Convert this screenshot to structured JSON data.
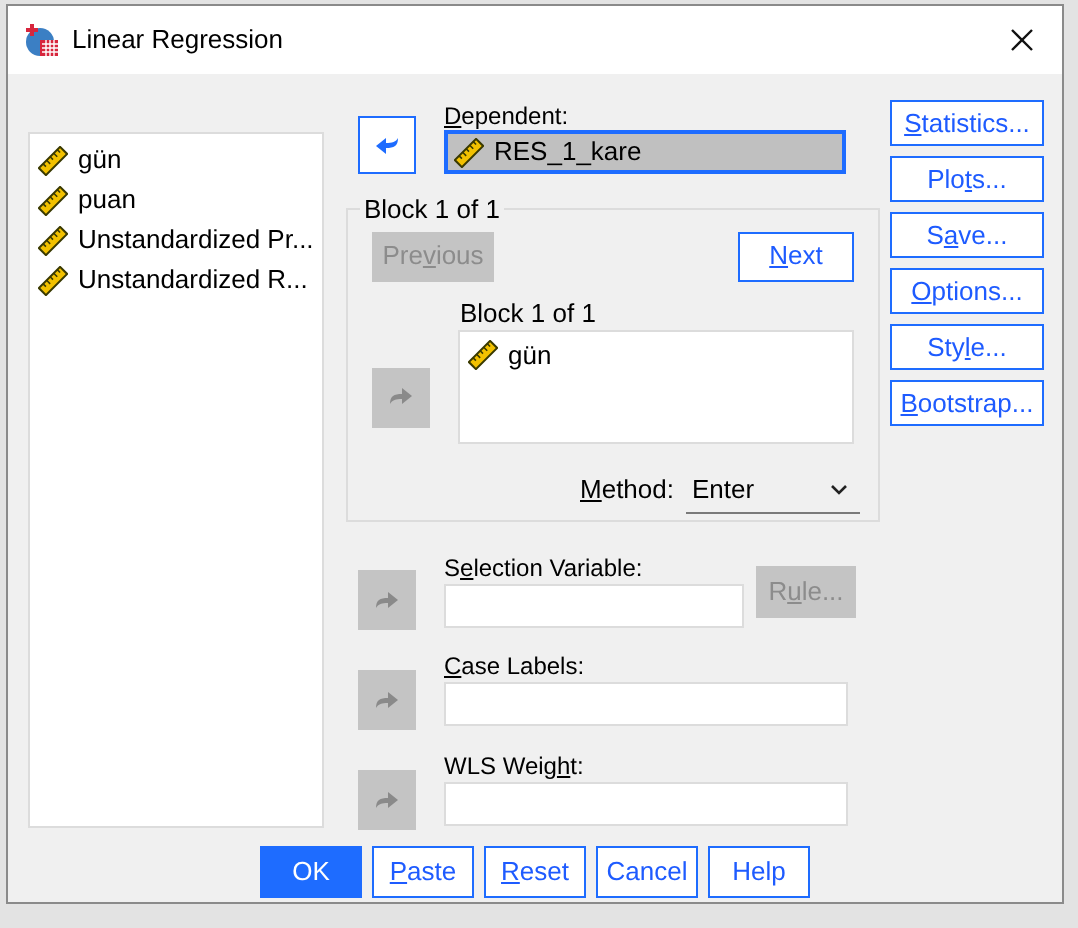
{
  "window": {
    "title": "Linear Regression"
  },
  "variables": [
    {
      "name": "gün"
    },
    {
      "name": "puan"
    },
    {
      "name": "Unstandardized Pr..."
    },
    {
      "name": "Unstandardized R..."
    }
  ],
  "dependent": {
    "label": {
      "key": "D",
      "post": "ependent:"
    },
    "arrow_disabled": false,
    "value": {
      "name": "RES_1_kare"
    }
  },
  "block": {
    "title": "Block 1 of 1",
    "previous": {
      "label": {
        "pre": "Pre",
        "key": "v",
        "post": "ious"
      },
      "disabled": true
    },
    "next": {
      "label": {
        "key": "N",
        "post": "ext"
      },
      "disabled": false
    },
    "list_title": "Block 1 of 1",
    "arrow_disabled": true,
    "independents": [
      {
        "name": "gün"
      }
    ],
    "method": {
      "label": {
        "key": "M",
        "post": "ethod:"
      },
      "value": "Enter"
    }
  },
  "selection": {
    "label": {
      "pre": "S",
      "key": "e",
      "post": "lection Variable:"
    },
    "arrow_disabled": true,
    "rule": {
      "label": {
        "pre": "R",
        "key": "u",
        "post": "le..."
      },
      "disabled": true
    }
  },
  "case_labels": {
    "label": {
      "key": "C",
      "post": "ase Labels:"
    },
    "arrow_disabled": true
  },
  "wls": {
    "label": {
      "pre": "WLS Weig",
      "key": "h",
      "post": "t:"
    },
    "arrow_disabled": true
  },
  "side_buttons": [
    {
      "label": {
        "key": "S",
        "post": "tatistics..."
      }
    },
    {
      "label": {
        "pre": "Plo",
        "key": "t",
        "post": "s..."
      }
    },
    {
      "label": {
        "pre": "S",
        "key": "a",
        "post": "ve..."
      }
    },
    {
      "label": {
        "key": "O",
        "post": "ptions..."
      }
    },
    {
      "label": {
        "pre": "Sty",
        "key": "l",
        "post": "e..."
      }
    },
    {
      "label": {
        "key": "B",
        "post": "ootstrap..."
      }
    }
  ],
  "bottom_buttons": [
    {
      "label": {
        "pre": "OK"
      },
      "focused": true
    },
    {
      "label": {
        "key": "P",
        "post": "aste"
      },
      "focused": false
    },
    {
      "label": {
        "key": "R",
        "post": "eset"
      },
      "focused": false
    },
    {
      "label": {
        "pre": "Cancel"
      },
      "focused": false
    },
    {
      "label": {
        "pre": "Help"
      },
      "focused": false
    }
  ]
}
